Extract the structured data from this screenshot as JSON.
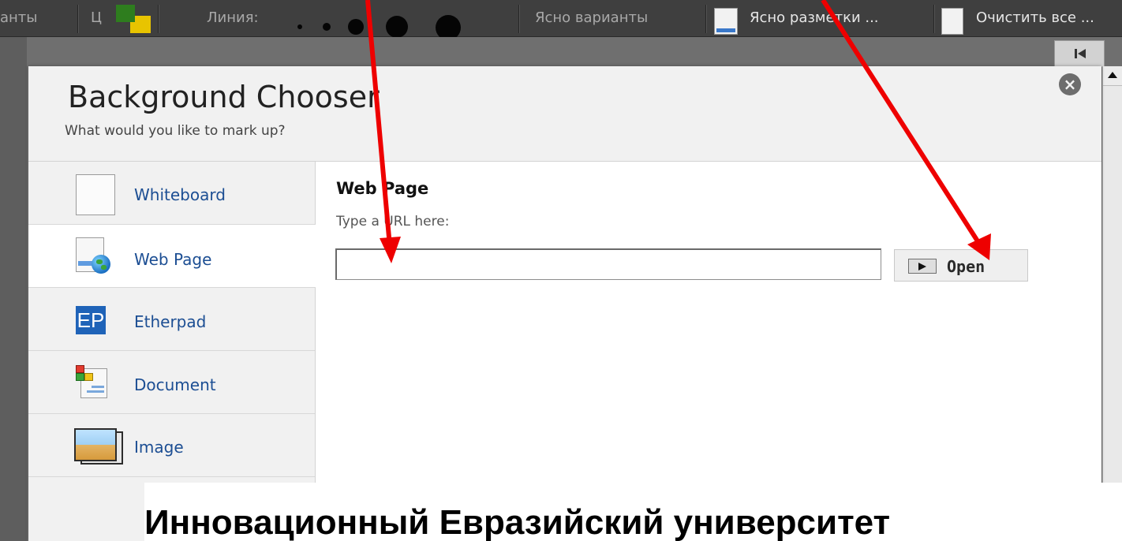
{
  "toolbar": {
    "item_fragment_1": "анты",
    "color_label_fragment": "Ц",
    "line_label": "Линия:",
    "clear_options": "Ясно варианты",
    "clear_markup": "Ясно разметки ...",
    "clear_all": "Очистить все ...",
    "color_swatches": [
      "#2e7d1e",
      "#e8c400"
    ]
  },
  "dialog": {
    "title": "Background Chooser",
    "subtitle": "What would you like to mark up?",
    "close_symbol": "×"
  },
  "sidebar": {
    "items": [
      {
        "label": "Whiteboard",
        "icon": "blank-page-icon",
        "active": false
      },
      {
        "label": "Web Page",
        "icon": "globe-page-icon",
        "active": true
      },
      {
        "label": "Etherpad",
        "icon": "etherpad-icon",
        "active": false
      },
      {
        "label": "Document",
        "icon": "document-icon",
        "active": false
      },
      {
        "label": "Image",
        "icon": "image-icon",
        "active": false
      }
    ],
    "etherpad_badge": "EP"
  },
  "web_page_panel": {
    "heading": "Web Page",
    "prompt": "Type a URL here:",
    "url_value": "",
    "open_button_label": "Open"
  },
  "caption": {
    "text": "Инновационный Евразийский университет"
  },
  "annotation_arrows": {
    "color": "#ee0000",
    "count": 2
  }
}
